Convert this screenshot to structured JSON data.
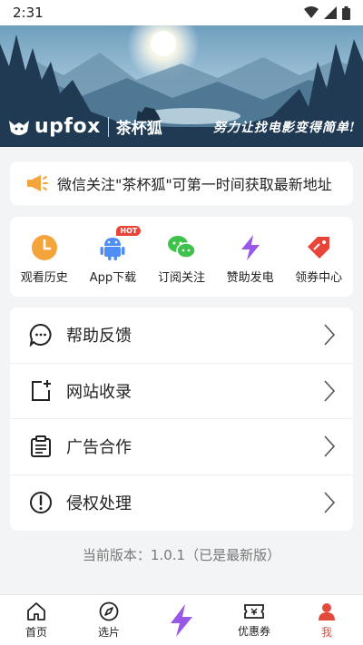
{
  "status_bar": {
    "time": "2:31"
  },
  "banner": {
    "logo_text": "upfox",
    "brand_cn": "茶杯狐",
    "slogan": "努力让找电影变得简单!"
  },
  "notice": {
    "text": "微信关注\"茶杯狐\"可第一时间获取最新地址",
    "icon": "megaphone-icon"
  },
  "quick_actions": [
    {
      "label": "观看历史",
      "icon": "clock-icon",
      "color": "#f3a53b"
    },
    {
      "label": "App下载",
      "icon": "android-icon",
      "color": "#4f8ff5",
      "badge": "HOT"
    },
    {
      "label": "订阅关注",
      "icon": "wechat-icon",
      "color": "#3fc24b"
    },
    {
      "label": "赞助发电",
      "icon": "lightning-icon",
      "color": "#9a58e6"
    },
    {
      "label": "领券中心",
      "icon": "coupon-icon",
      "color": "#e8443a"
    }
  ],
  "menu": [
    {
      "label": "帮助反馈",
      "icon": "chat-bubble-icon"
    },
    {
      "label": "网站收录",
      "icon": "add-page-icon"
    },
    {
      "label": "广告合作",
      "icon": "clipboard-icon"
    },
    {
      "label": "侵权处理",
      "icon": "alert-circle-icon"
    }
  ],
  "version_text": "当前版本：1.0.1（已是最新版）",
  "tabbar": {
    "active": "我",
    "tabs": [
      {
        "label": "首页",
        "icon": "home-icon"
      },
      {
        "label": "选片",
        "icon": "compass-icon"
      },
      {
        "label": "",
        "icon": "lightning-icon"
      },
      {
        "label": "优惠券",
        "icon": "ticket-icon"
      },
      {
        "label": "我",
        "icon": "user-icon"
      }
    ]
  },
  "colors": {
    "accent": "#e24b3b",
    "purple": "#9a58e6",
    "background": "#f3f4f6"
  }
}
